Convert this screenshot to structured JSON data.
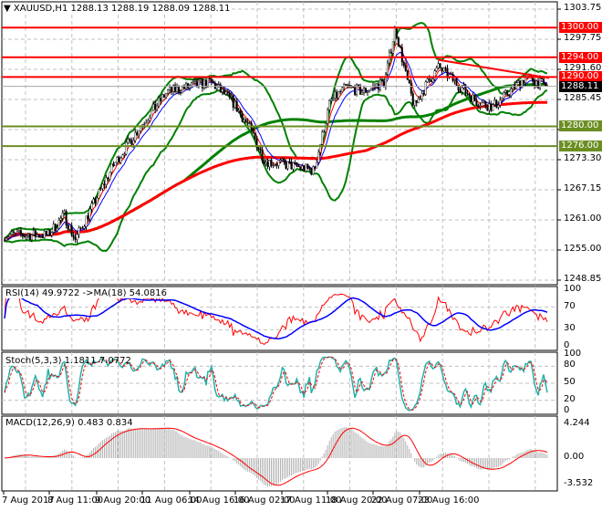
{
  "header": {
    "symbol": "XAUUSD,H1",
    "ohlc": "1288.13 1288.19 1288.09 1288.11"
  },
  "price_axis": [
    "1303.75",
    "1297.75",
    "1291.60",
    "1285.45",
    "1279.30",
    "1273.30",
    "1267.15",
    "1261.00",
    "1255.00",
    "1248.85"
  ],
  "price_range": [
    1248.85,
    1303.75
  ],
  "levels": [
    {
      "label": "1300.00",
      "value": 1300,
      "color": "#ff0000"
    },
    {
      "label": "1294.00",
      "value": 1294,
      "color": "#ff0000"
    },
    {
      "label": "1290.00",
      "value": 1290,
      "color": "#ff0000"
    },
    {
      "label": "1280.00",
      "value": 1280,
      "color": "#6b8e23"
    },
    {
      "label": "1276.00",
      "value": 1276,
      "color": "#6b8e23"
    }
  ],
  "current_price": {
    "label": "1288.11",
    "value": 1288.11
  },
  "trendline": {
    "from": 1293.5,
    "to": 1289.8,
    "color": "#ff0000"
  },
  "rsi": {
    "title": "RSI(14) 49.9722  ->MA(18) 54.0816",
    "axis": [
      "100",
      "70",
      "30",
      "0"
    ]
  },
  "stoch": {
    "title": "Stoch(5,3,3) 1.1811 7.0772",
    "axis": [
      "100",
      "80",
      "50",
      "20",
      "0"
    ]
  },
  "macd": {
    "title": "MACD(12,26,9) 0.483 0.834",
    "axis": [
      "4.244",
      "0.00",
      "-3.532"
    ]
  },
  "time_axis": [
    "7 Aug 2017",
    "8 Aug 11:00",
    "9 Aug 20:00",
    "11 Aug 06:00",
    "14 Aug 16:00",
    "16 Aug 02:00",
    "17 Aug 11:00",
    "18 Aug 20:00",
    "22 Aug 07:00",
    "23 Aug 16:00"
  ],
  "price_keypoints": [
    [
      0,
      1258
    ],
    [
      0.08,
      1258
    ],
    [
      0.11,
      1262
    ],
    [
      0.13,
      1257
    ],
    [
      0.2,
      1272
    ],
    [
      0.25,
      1280
    ],
    [
      0.3,
      1287
    ],
    [
      0.38,
      1289
    ],
    [
      0.42,
      1285
    ],
    [
      0.45,
      1280
    ],
    [
      0.48,
      1273
    ],
    [
      0.53,
      1272
    ],
    [
      0.57,
      1271
    ],
    [
      0.6,
      1285
    ],
    [
      0.63,
      1288
    ],
    [
      0.66,
      1287
    ],
    [
      0.7,
      1289
    ],
    [
      0.72,
      1300
    ],
    [
      0.74,
      1290
    ],
    [
      0.755,
      1284
    ],
    [
      0.78,
      1289
    ],
    [
      0.8,
      1292
    ],
    [
      0.84,
      1288
    ],
    [
      0.87,
      1285
    ],
    [
      0.9,
      1284
    ],
    [
      0.93,
      1287
    ],
    [
      0.96,
      1290
    ],
    [
      1,
      1288.11
    ]
  ]
}
